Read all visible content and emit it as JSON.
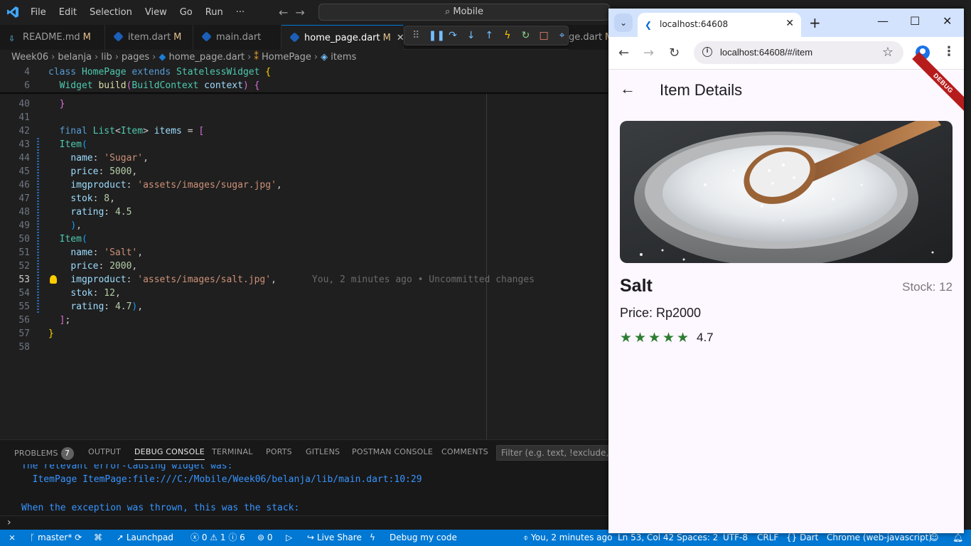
{
  "vscode": {
    "menu": [
      "File",
      "Edit",
      "Selection",
      "View",
      "Go",
      "Run",
      "···"
    ],
    "search": "Mobile",
    "tabs": [
      {
        "label": "README.md",
        "mod": "M"
      },
      {
        "label": "item.dart",
        "mod": "M"
      },
      {
        "label": "main.dart",
        "mod": ""
      },
      {
        "label": "home_page.dart",
        "mod": "M"
      },
      {
        "label": "ge.dart",
        "mod": "M"
      }
    ],
    "breadcrumb": [
      "Week06",
      "belanja",
      "lib",
      "pages",
      "home_page.dart",
      "HomePage",
      "items"
    ],
    "blame": "You, 2 minutes ago • Uncommitted changes",
    "panel": {
      "tabs": [
        "PROBLEMS",
        "OUTPUT",
        "DEBUG CONSOLE",
        "TERMINAL",
        "PORTS",
        "GITLENS",
        "POSTMAN CONSOLE",
        "COMMENTS"
      ],
      "problems_count": "7",
      "filter_placeholder": "Filter (e.g. text, !exclude, \\esc",
      "console_lines": [
        "The relevant error-causing widget was:",
        "  ItemPage ItemPage:file:///C:/Mobile/Week06/belanja/lib/main.dart:10:29",
        "When the exception was thrown, this was the stack:"
      ],
      "prompt": "›"
    },
    "status": {
      "branch": "master*",
      "launchpad": "Launchpad",
      "errors": "0",
      "warnings": "1",
      "infos": "6",
      "ports": "0",
      "live_share": "Live Share",
      "debug": "Debug my code",
      "blame": "You, 2 minutes ago",
      "position": "Ln 53, Col 42",
      "spaces": "Spaces: 2",
      "encoding": "UTF-8",
      "eol": "CRLF",
      "language": "{} Dart",
      "device": "Chrome (web-javascript)"
    }
  },
  "chrome": {
    "tab_title": "localhost:64608",
    "url": "localhost:64608/#/item"
  },
  "app": {
    "title": "Item Details",
    "debug_banner": "DEBUG",
    "product": {
      "name": "Salt",
      "stock": "Stock: 12",
      "price": "Price: Rp2000",
      "rating": 4.7,
      "rating_label": "4.7",
      "image_icon": "salt-bowl-image"
    }
  },
  "colors": {
    "accent": "#0078d4",
    "star": "#2e7d32",
    "app_bg": "#fdf7ff"
  }
}
